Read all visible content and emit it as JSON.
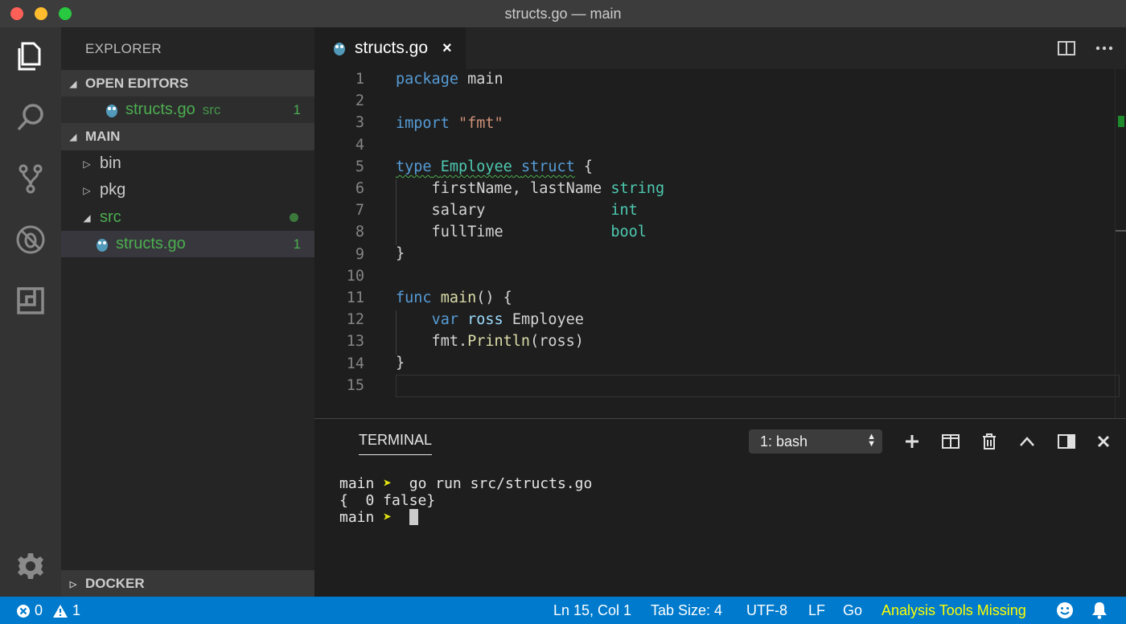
{
  "window": {
    "title": "structs.go — main"
  },
  "activity_bar": {
    "items": [
      "explorer-icon",
      "search-icon",
      "source-control-icon",
      "debug-icon",
      "extensions-icon"
    ],
    "bottom": "gear-icon"
  },
  "sidebar": {
    "title": "EXPLORER",
    "open_editors": {
      "label": "OPEN EDITORS",
      "items": [
        {
          "name": "structs.go",
          "folder": "src",
          "badge": "1"
        }
      ]
    },
    "main": {
      "label": "MAIN",
      "items": [
        {
          "name": "bin",
          "type": "folder"
        },
        {
          "name": "pkg",
          "type": "folder"
        },
        {
          "name": "src",
          "type": "folder",
          "expanded": true
        },
        {
          "name": "structs.go",
          "type": "file",
          "badge": "1"
        }
      ]
    },
    "docker": {
      "label": "DOCKER"
    }
  },
  "editor": {
    "tab": {
      "label": "structs.go",
      "close": "×"
    },
    "line_numbers": [
      "1",
      "2",
      "3",
      "4",
      "5",
      "6",
      "7",
      "8",
      "9",
      "10",
      "11",
      "12",
      "13",
      "14",
      "15"
    ]
  },
  "terminal": {
    "title": "TERMINAL",
    "selected_shell": "1: bash",
    "lines": [
      {
        "dir": "main",
        "arrow": "➤",
        "cmd": "go run src/structs.go"
      },
      {
        "output": "{  0 false}"
      },
      {
        "dir": "main",
        "arrow": "➤",
        "cmd": ""
      }
    ]
  },
  "status_bar": {
    "errors": "0",
    "warnings": "1",
    "position": "Ln 15, Col 1",
    "tab_size": "Tab Size: 4",
    "encoding": "UTF-8",
    "eol": "LF",
    "language": "Go",
    "analysis": "Analysis Tools Missing"
  },
  "colors": {
    "status_bar": "#007acc",
    "git_added": "#4cae4f",
    "warning_text": "#ffff00"
  }
}
